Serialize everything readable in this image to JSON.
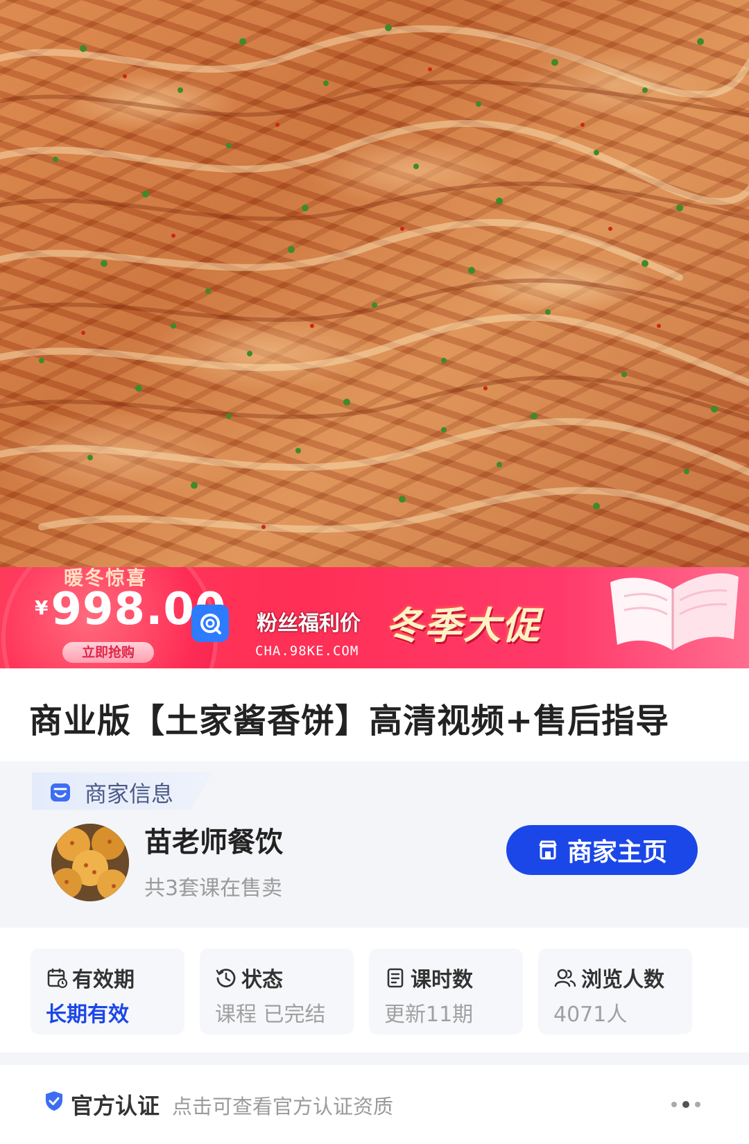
{
  "promo": {
    "tag": "暖冬惊喜",
    "currency": "¥",
    "price": "998.00",
    "buy_label": "立即抢购",
    "fans_label": "粉丝福利价",
    "watermark": "CHA.98KE.COM",
    "title": "冬季大促"
  },
  "course": {
    "title": "商业版【土家酱香饼】高清视频+售后指导"
  },
  "merchant": {
    "section_label": "商家信息",
    "name": "苗老师餐饮",
    "subtitle": "共3套课在售卖",
    "home_label": "商家主页"
  },
  "stats": [
    {
      "icon": "calendar-icon",
      "label": "有效期",
      "value": "长期有效"
    },
    {
      "icon": "clock-icon",
      "label": "状态",
      "value": "课程 已完结"
    },
    {
      "icon": "document-icon",
      "label": "课时数",
      "value": "更新11期"
    },
    {
      "icon": "users-icon",
      "label": "浏览人数",
      "value": "4071人"
    }
  ],
  "certification": {
    "label": "官方认证",
    "description": "点击可查看官方认证资质"
  },
  "colors": {
    "accent_blue": "#1b47e8",
    "promo_red": "#ff2f55"
  }
}
